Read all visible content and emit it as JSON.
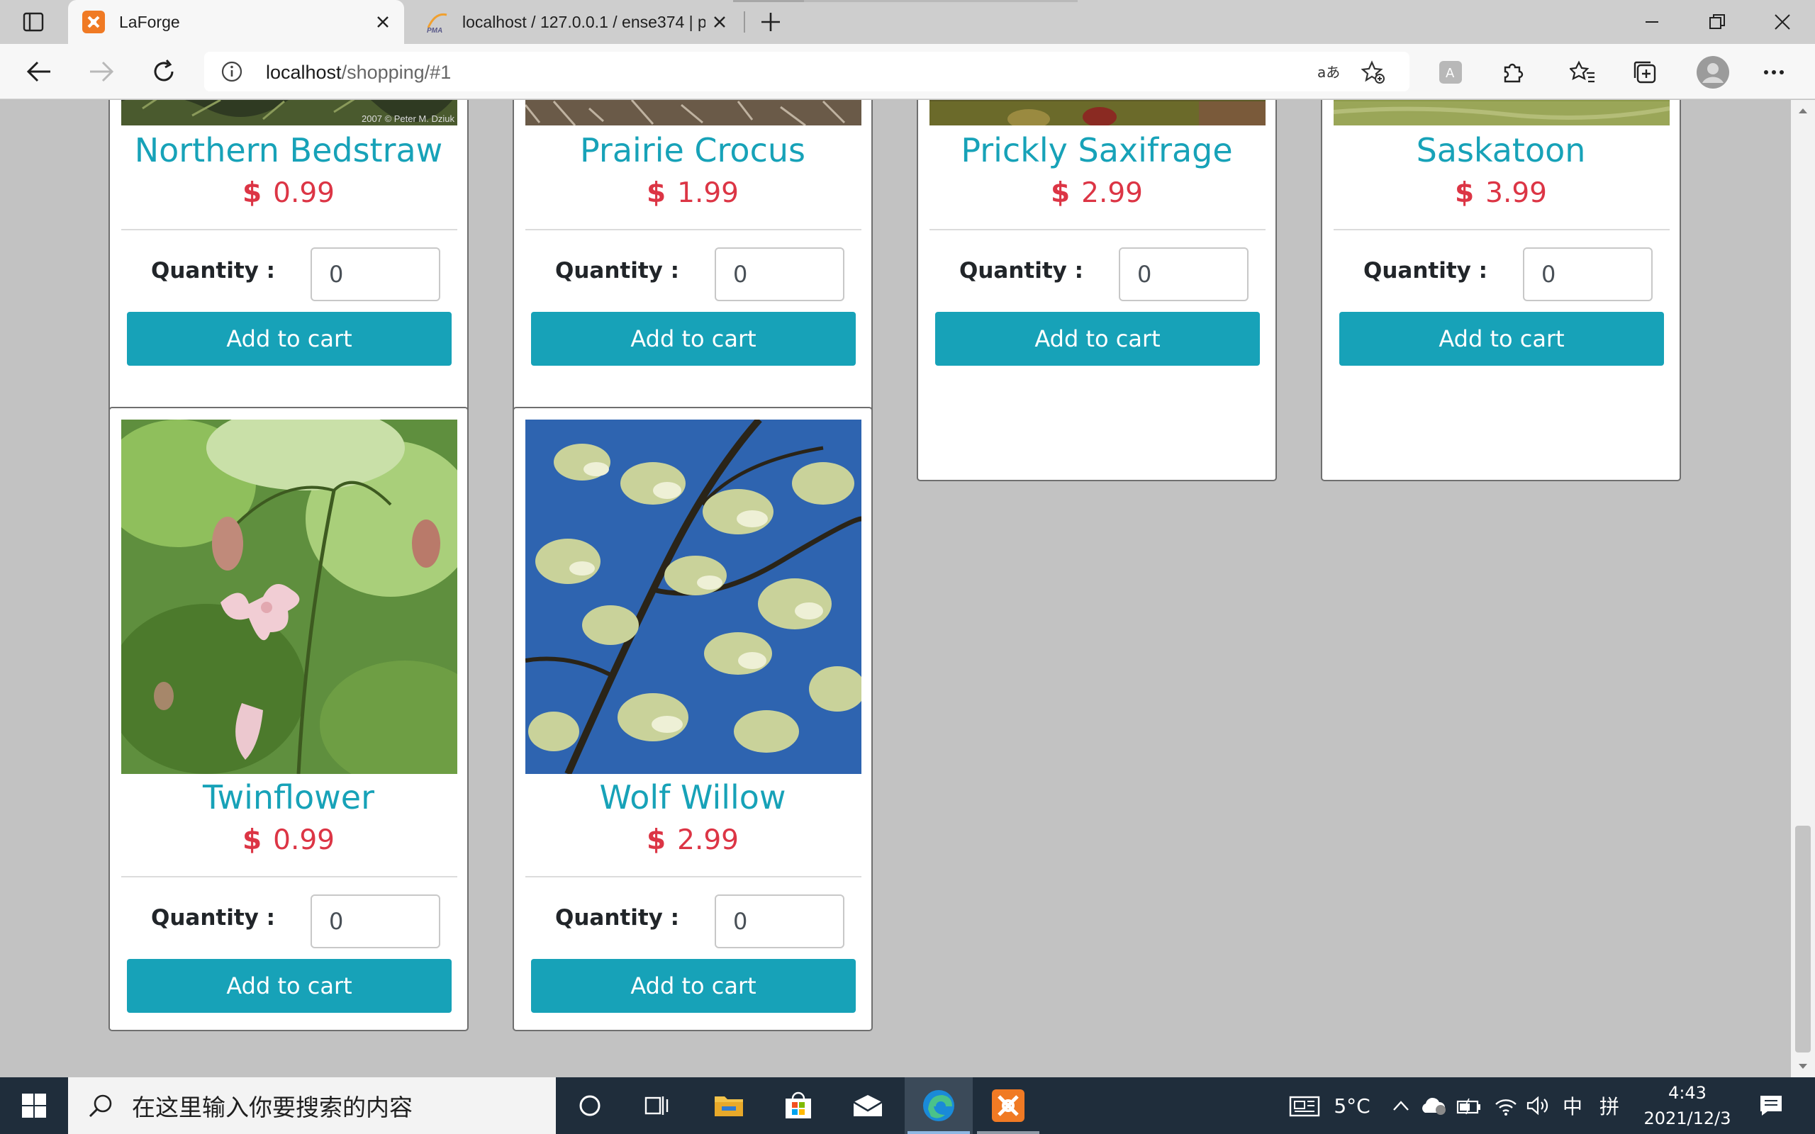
{
  "browser": {
    "tabs": [
      {
        "title": "LaForge",
        "active": true
      },
      {
        "title": "localhost / 127.0.0.1 / ense374 | p",
        "active": false
      }
    ],
    "url_host": "localhost",
    "url_path": "/shopping/#1",
    "accent": "#17a2b8"
  },
  "products": [
    {
      "name": "Northern Bedstraw",
      "currency": "$",
      "price": "0.99",
      "quantity_label": "Quantity :",
      "quantity": "0",
      "button": "Add to cart",
      "photo_credit": "2007 © Peter M. Dziuk"
    },
    {
      "name": "Prairie Crocus",
      "currency": "$",
      "price": "1.99",
      "quantity_label": "Quantity :",
      "quantity": "0",
      "button": "Add to cart"
    },
    {
      "name": "Prickly Saxifrage",
      "currency": "$",
      "price": "2.99",
      "quantity_label": "Quantity :",
      "quantity": "0",
      "button": "Add to cart"
    },
    {
      "name": "Saskatoon",
      "currency": "$",
      "price": "3.99",
      "quantity_label": "Quantity :",
      "quantity": "0",
      "button": "Add to cart"
    },
    {
      "name": "Twinflower",
      "currency": "$",
      "price": "0.99",
      "quantity_label": "Quantity :",
      "quantity": "0",
      "button": "Add to cart"
    },
    {
      "name": "Wolf Willow",
      "currency": "$",
      "price": "2.99",
      "quantity_label": "Quantity :",
      "quantity": "0",
      "button": "Add to cart"
    }
  ],
  "taskbar": {
    "search_placeholder": "在这里输入你要搜索的内容",
    "weather": "5°C",
    "ime_lang": "中",
    "ime_mode": "拼",
    "time": "4:43",
    "date": "2021/12/3"
  }
}
